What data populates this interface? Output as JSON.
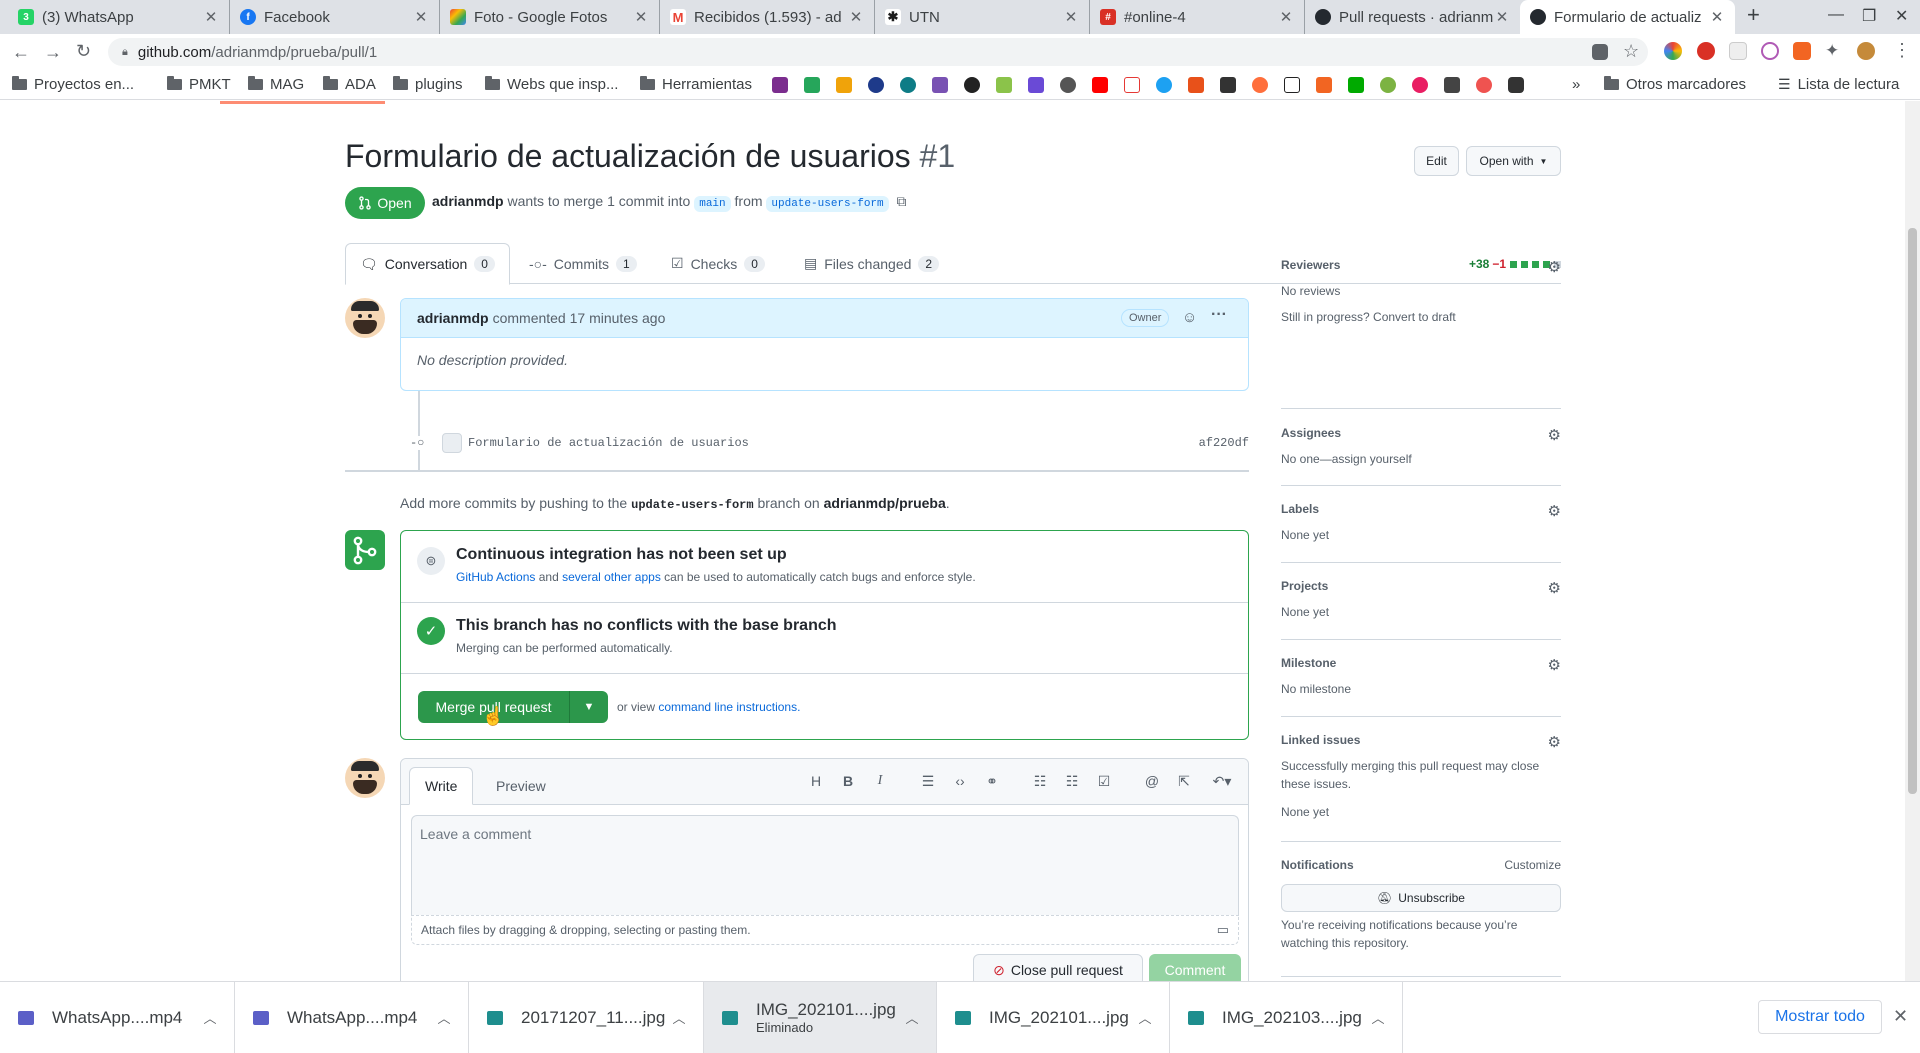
{
  "browser": {
    "tabs": [
      {
        "title": "(3) WhatsApp",
        "favicon": "whatsapp-icon",
        "color": "#25d366",
        "glyph": "3"
      },
      {
        "title": "Facebook",
        "favicon": "facebook-icon",
        "color": "#1877f2",
        "glyph": "f"
      },
      {
        "title": "Foto - Google Fotos",
        "favicon": "google-photos-icon",
        "color": "#fbbc05",
        "glyph": "✱"
      },
      {
        "title": "Recibidos (1.593) - ad",
        "favicon": "gmail-icon",
        "color": "#ea4335",
        "glyph": "M"
      },
      {
        "title": "UTN",
        "favicon": "utn-icon",
        "color": "#1d1d1d",
        "glyph": "✱"
      },
      {
        "title": "#online-4",
        "favicon": "calendar-icon",
        "color": "#d93025",
        "glyph": "#"
      },
      {
        "title": "Pull requests · adrianm",
        "favicon": "github-icon",
        "color": "#24292f",
        "glyph": "●"
      },
      {
        "title": "Formulario de actualiz",
        "favicon": "github-icon",
        "color": "#24292f",
        "glyph": "●"
      }
    ],
    "new_tab": "+",
    "url_host": "github.com",
    "url_path": "/adrianmdp/prueba/pull/1",
    "bookmarks": [
      "Proyectos en...",
      "PMKT",
      "MAG",
      "ADA",
      "plugins",
      "Webs que insp...",
      "Herramientas"
    ],
    "bookmarks_more": "»",
    "other_bookmarks": "Otros marcadores",
    "reading_list": "Lista de lectura"
  },
  "pr": {
    "title": "Formulario de actualización de usuarios",
    "number": "#1",
    "edit_label": "Edit",
    "open_with_label": "Open with",
    "state_label": "Open",
    "author": "adrianmdp",
    "merge_text": "wants to merge 1 commit into",
    "base_branch": "main",
    "from_text": "from",
    "head_branch": "update-users-form",
    "tabs": [
      {
        "label": "Conversation",
        "count": "0"
      },
      {
        "label": "Commits",
        "count": "1"
      },
      {
        "label": "Checks",
        "count": "0"
      },
      {
        "label": "Files changed",
        "count": "2"
      }
    ],
    "additions": "+38",
    "deletions": "−1"
  },
  "comment": {
    "author": "adrianmdp",
    "action": "commented",
    "time": "17 minutes ago",
    "badge": "Owner",
    "body": "No description provided."
  },
  "commit": {
    "message": "Formulario de actualización de usuarios",
    "sha": "af220df"
  },
  "push_hint": {
    "prefix": "Add more commits by pushing to the",
    "branch": "update-users-form",
    "middle": "branch on",
    "repo": "adrianmdp/prueba",
    "suffix": "."
  },
  "merge": {
    "ci_title": "Continuous integration has not been set up",
    "ci_link1": "GitHub Actions",
    "ci_and": "and",
    "ci_link2": "several other apps",
    "ci_rest": "can be used to automatically catch bugs and enforce style.",
    "conflict_title": "This branch has no conflicts with the base branch",
    "conflict_sub": "Merging can be performed automatically.",
    "merge_button": "Merge pull request",
    "or_view": "or view",
    "cli_link": "command line instructions."
  },
  "editor": {
    "write_tab": "Write",
    "preview_tab": "Preview",
    "placeholder": "Leave a comment",
    "attach_hint": "Attach files by dragging & dropping, selecting or pasting them.",
    "close_button": "Close pull request",
    "comment_button": "Comment"
  },
  "sidebar": {
    "reviewers_title": "Reviewers",
    "reviewers_value": "No reviews",
    "reviewers_extra": "Still in progress? Convert to draft",
    "assignees_title": "Assignees",
    "assignees_value": "No one—assign yourself",
    "labels_title": "Labels",
    "labels_value": "None yet",
    "projects_title": "Projects",
    "projects_value": "None yet",
    "milestone_title": "Milestone",
    "milestone_value": "No milestone",
    "linked_title": "Linked issues",
    "linked_desc": "Successfully merging this pull request may close these issues.",
    "linked_value": "None yet",
    "notifications_title": "Notifications",
    "customize": "Customize",
    "unsubscribe": "Unsubscribe",
    "notif_desc": "You’re receiving notifications because you’re watching this repository."
  },
  "downloads": {
    "items": [
      {
        "name": "WhatsApp....mp4",
        "status": ""
      },
      {
        "name": "WhatsApp....mp4",
        "status": ""
      },
      {
        "name": "20171207_11....jpg",
        "status": ""
      },
      {
        "name": "IMG_202101....jpg",
        "status": "Eliminado"
      },
      {
        "name": "IMG_202101....jpg",
        "status": ""
      },
      {
        "name": "IMG_202103....jpg",
        "status": ""
      }
    ],
    "show_all": "Mostrar todo"
  }
}
